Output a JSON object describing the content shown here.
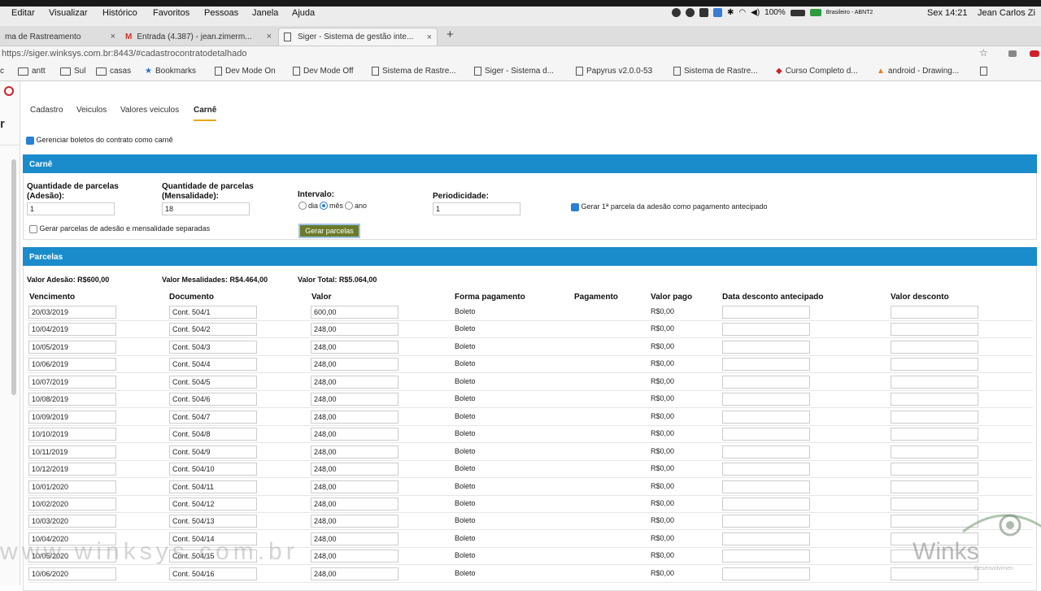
{
  "menubar": {
    "items": [
      "Editar",
      "Visualizar",
      "Histórico",
      "Favoritos",
      "Pessoas",
      "Janela",
      "Ajuda"
    ],
    "status": {
      "battery": "100%",
      "keyboard": "Brasileiro - ABNT2",
      "clock": "Sex 14:21",
      "user": "Jean Carlos Zi"
    }
  },
  "tabs": [
    {
      "label": "ma de Rastreamento"
    },
    {
      "label": "Entrada (4.387) - jean.zimerm..."
    },
    {
      "label": "Siger - Sistema de gestão inte..."
    }
  ],
  "url": "https://siger.winksys.com.br:8443/#cadastrocontratodetalhado",
  "bookmarks": [
    "c",
    "antt",
    "Sul",
    "casas",
    "Bookmarks",
    "Dev Mode On",
    "Dev Mode Off",
    "Sistema de Rastre...",
    "Siger - Sistema d...",
    "Papyrus v2.0.0-53",
    "Sistema de Rastre...",
    "Curso Completo d...",
    "android - Drawing..."
  ],
  "nav_tabs": [
    "Cadastro",
    "Veiculos",
    "Valores veiculos",
    "Carnê"
  ],
  "manage_label": "Gerenciar boletos do contrato como carnê",
  "carne": {
    "header": "Carnê",
    "qtd_adesao_label1": "Quantidade de parcelas",
    "qtd_adesao_label2": "(Adesão):",
    "qtd_adesao_value": "1",
    "qtd_mens_label1": "Quantidade de parcelas",
    "qtd_mens_label2": "(Mensalidade):",
    "qtd_mens_value": "18",
    "intervalo_label": "Intervalo:",
    "interval_dia": "dia",
    "interval_mes": "mês",
    "interval_ano": "ano",
    "periodicidade_label": "Periodicidade:",
    "periodicidade_value": "1",
    "first_parcel_label": "Gerar 1ª parcela da adesão como pagamento antecipado",
    "separate_label": "Gerar parcelas de adesão e mensalidade separadas",
    "gen_button": "Gerar parcelas"
  },
  "parcelas": {
    "header": "Parcelas",
    "valor_adesao": "Valor Adesão: R$600,00",
    "valor_mensalidades": "Valor Mesalidades: R$4.464,00",
    "valor_total": "Valor Total: R$5.064,00",
    "columns": [
      "Vencimento",
      "Documento",
      "Valor",
      "Forma pagamento",
      "Pagamento",
      "Valor pago",
      "Data desconto antecipado",
      "Valor desconto"
    ],
    "rows": [
      {
        "venc": "20/03/2019",
        "doc": "Cont. 504/1",
        "valor": "600,00",
        "forma": "Boleto",
        "pago": "R$0,00"
      },
      {
        "venc": "10/04/2019",
        "doc": "Cont. 504/2",
        "valor": "248,00",
        "forma": "Boleto",
        "pago": "R$0,00"
      },
      {
        "venc": "10/05/2019",
        "doc": "Cont. 504/3",
        "valor": "248,00",
        "forma": "Boleto",
        "pago": "R$0,00"
      },
      {
        "venc": "10/06/2019",
        "doc": "Cont. 504/4",
        "valor": "248,00",
        "forma": "Boleto",
        "pago": "R$0,00"
      },
      {
        "venc": "10/07/2019",
        "doc": "Cont. 504/5",
        "valor": "248,00",
        "forma": "Boleto",
        "pago": "R$0,00"
      },
      {
        "venc": "10/08/2019",
        "doc": "Cont. 504/6",
        "valor": "248,00",
        "forma": "Boleto",
        "pago": "R$0,00"
      },
      {
        "venc": "10/09/2019",
        "doc": "Cont. 504/7",
        "valor": "248,00",
        "forma": "Boleto",
        "pago": "R$0,00"
      },
      {
        "venc": "10/10/2019",
        "doc": "Cont. 504/8",
        "valor": "248,00",
        "forma": "Boleto",
        "pago": "R$0,00"
      },
      {
        "venc": "10/11/2019",
        "doc": "Cont. 504/9",
        "valor": "248,00",
        "forma": "Boleto",
        "pago": "R$0,00"
      },
      {
        "venc": "10/12/2019",
        "doc": "Cont. 504/10",
        "valor": "248,00",
        "forma": "Boleto",
        "pago": "R$0,00"
      },
      {
        "venc": "10/01/2020",
        "doc": "Cont. 504/11",
        "valor": "248,00",
        "forma": "Boleto",
        "pago": "R$0,00"
      },
      {
        "venc": "10/02/2020",
        "doc": "Cont. 504/12",
        "valor": "248,00",
        "forma": "Boleto",
        "pago": "R$0,00"
      },
      {
        "venc": "10/03/2020",
        "doc": "Cont. 504/13",
        "valor": "248,00",
        "forma": "Boleto",
        "pago": "R$0,00"
      },
      {
        "venc": "10/04/2020",
        "doc": "Cont. 504/14",
        "valor": "248,00",
        "forma": "Boleto",
        "pago": "R$0,00"
      },
      {
        "venc": "10/05/2020",
        "doc": "Cont. 504/15",
        "valor": "248,00",
        "forma": "Boleto",
        "pago": "R$0,00"
      },
      {
        "venc": "10/06/2020",
        "doc": "Cont. 504/16",
        "valor": "248,00",
        "forma": "Boleto",
        "pago": "R$0,00"
      }
    ]
  },
  "watermark": {
    "url": "www.winksys.com.br",
    "logo": "Winks",
    "logo_sub": "Desenvolvimen"
  },
  "colors": {
    "header_blue": "#1a8bcb",
    "button_olive": "#6b7a2a",
    "active_tab_underline": "#e6a817"
  }
}
